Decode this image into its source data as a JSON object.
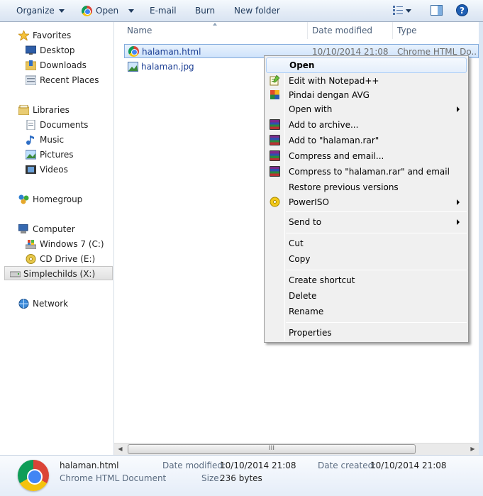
{
  "toolbar": {
    "organize": "Organize",
    "open": "Open",
    "email": "E-mail",
    "burn": "Burn",
    "new_folder": "New folder"
  },
  "nav": {
    "favorites": "Favorites",
    "desktop": "Desktop",
    "downloads": "Downloads",
    "recent_places": "Recent Places",
    "libraries": "Libraries",
    "documents": "Documents",
    "music": "Music",
    "pictures": "Pictures",
    "videos": "Videos",
    "homegroup": "Homegroup",
    "computer": "Computer",
    "windows7": "Windows 7 (C:)",
    "cd_drive": "CD Drive (E:)",
    "simplechilds": "Simplechilds (X:)",
    "network": "Network"
  },
  "columns": {
    "name": "Name",
    "date_modified": "Date modified",
    "type": "Type"
  },
  "files": [
    {
      "name": "halaman.html",
      "date": "10/10/2014 21:08",
      "type": "Chrome HTML Do..."
    },
    {
      "name": "halaman.jpg",
      "date": "",
      "type": ""
    }
  ],
  "context_menu": {
    "open": "Open",
    "notepad": "Edit with Notepad++",
    "avg": "Pindai dengan AVG",
    "open_with": "Open with",
    "add_archive": "Add to archive...",
    "add_rar": "Add to \"halaman.rar\"",
    "compress_email": "Compress and email...",
    "compress_rar_email": "Compress to \"halaman.rar\" and email",
    "restore": "Restore previous versions",
    "poweriso": "PowerISO",
    "send_to": "Send to",
    "cut": "Cut",
    "copy": "Copy",
    "create_shortcut": "Create shortcut",
    "delete": "Delete",
    "rename": "Rename",
    "properties": "Properties"
  },
  "details": {
    "filename": "halaman.html",
    "filetype": "Chrome HTML Document",
    "date_modified_label": "Date modified:",
    "date_modified": "10/10/2014 21:08",
    "size_label": "Size:",
    "size": "236 bytes",
    "date_created_label": "Date created:",
    "date_created": "10/10/2014 21:08"
  },
  "scrollbar": {
    "grip": "III"
  }
}
